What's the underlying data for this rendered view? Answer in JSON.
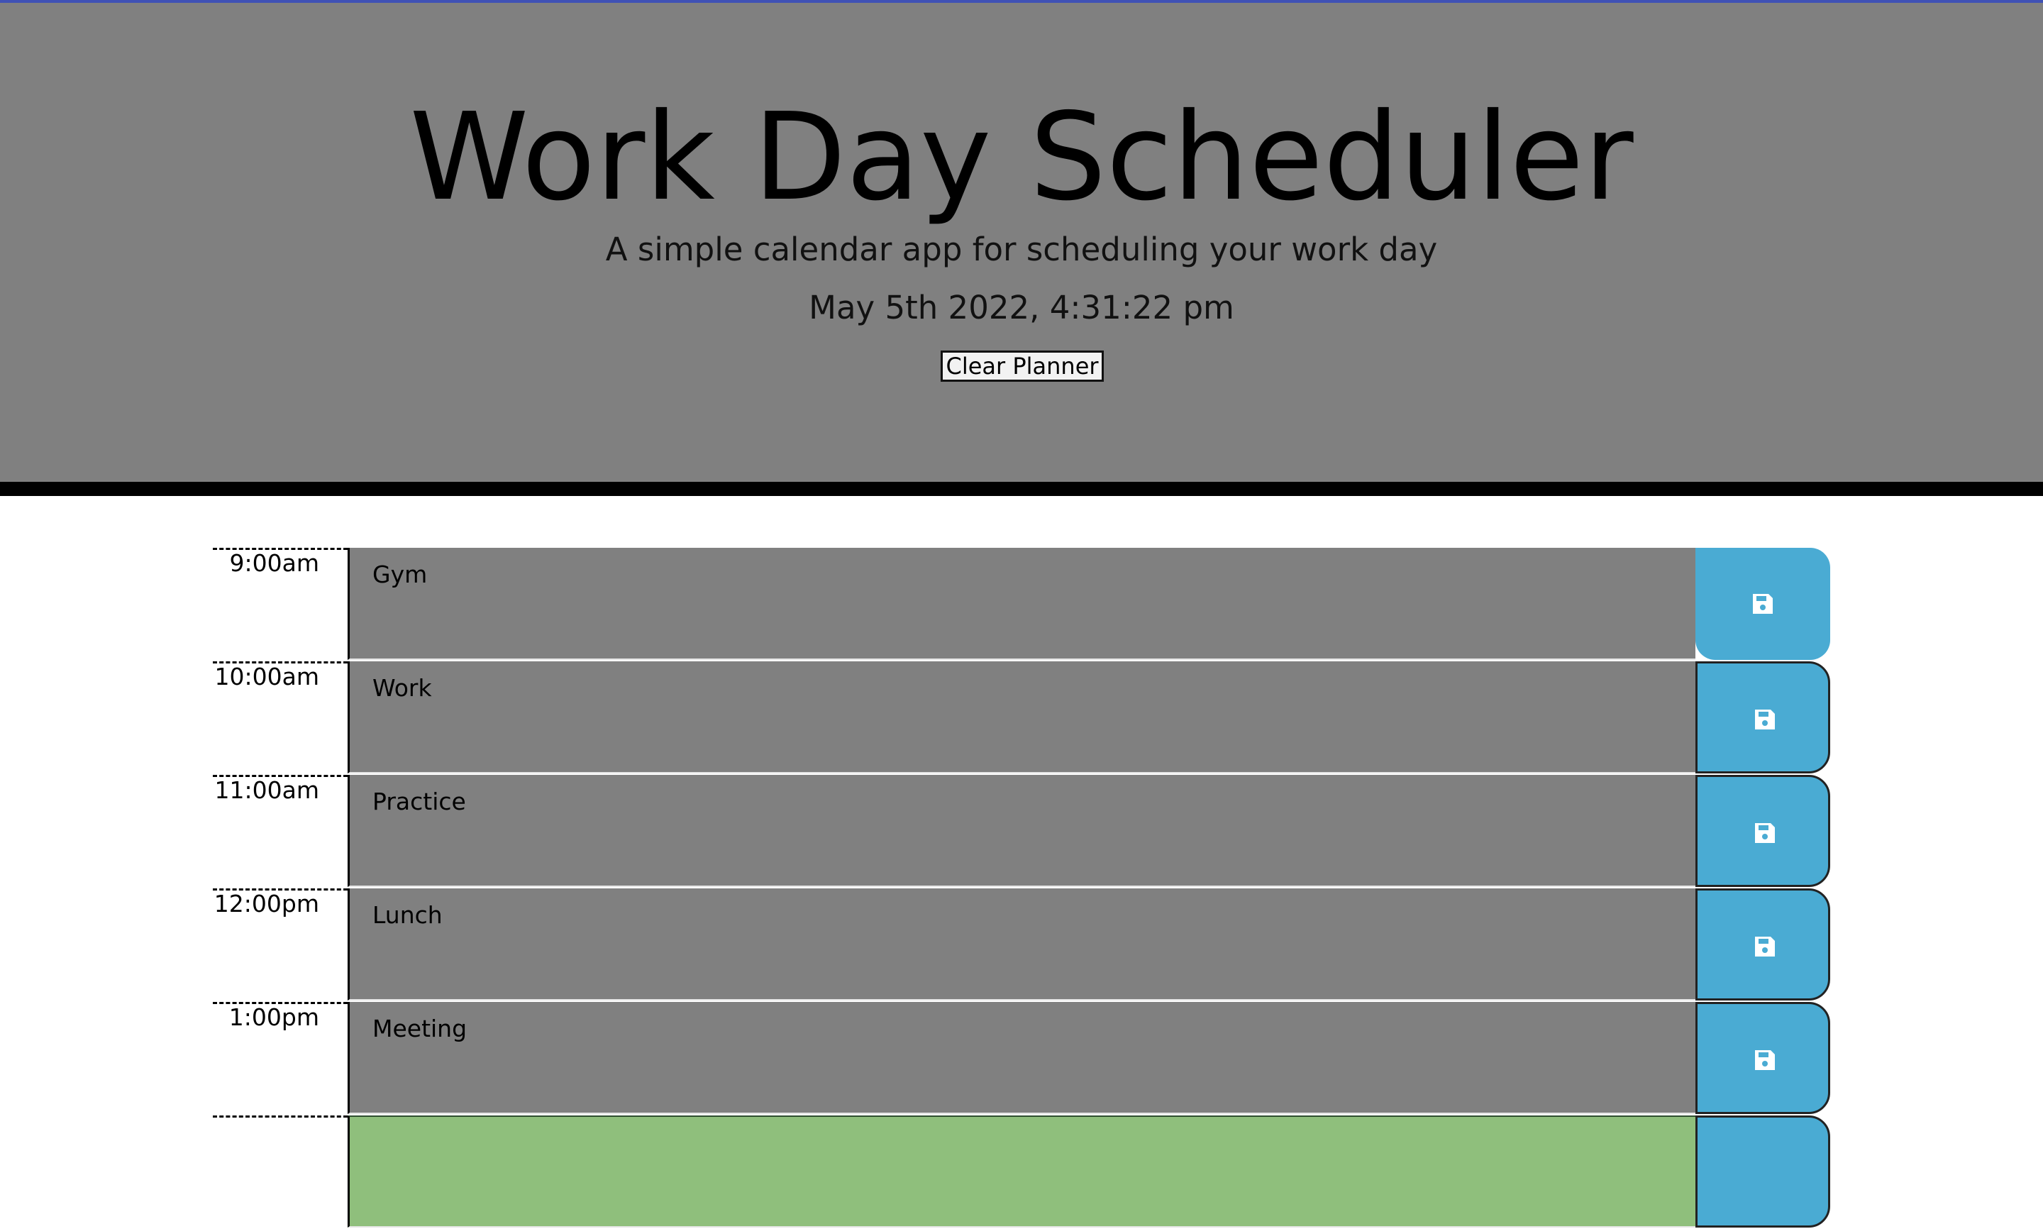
{
  "header": {
    "title": "Work Day Scheduler",
    "subtitle": "A simple calendar app for scheduling your work day",
    "datetime": "May 5th 2022, 4:31:22 pm",
    "clear_button": "Clear Planner"
  },
  "colors": {
    "header_bg": "#808080",
    "row_bg_past": "#808080",
    "row_bg_future": "#8fbf7c",
    "save_button": "#4aabd3",
    "top_line": "#3f51b5"
  },
  "rows": [
    {
      "hour": "9:00am",
      "text": "Gym",
      "icon": "save-icon"
    },
    {
      "hour": "10:00am",
      "text": "Work",
      "icon": "save-icon"
    },
    {
      "hour": "11:00am",
      "text": "Practice",
      "icon": "save-icon"
    },
    {
      "hour": "12:00pm",
      "text": "Lunch",
      "icon": "save-icon"
    },
    {
      "hour": "1:00pm",
      "text": "Meeting",
      "icon": "save-icon"
    }
  ]
}
